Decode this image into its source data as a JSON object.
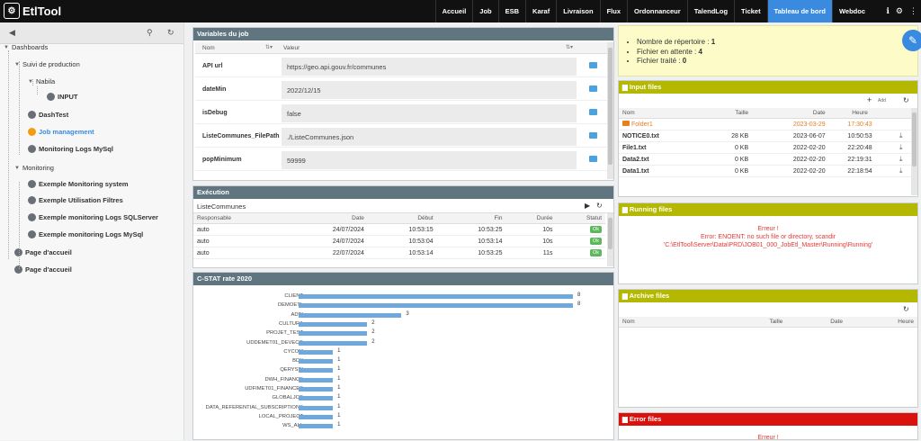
{
  "app": {
    "name": "EtlTool"
  },
  "nav": {
    "items": [
      "Accueil",
      "Job",
      "ESB",
      "Karaf",
      "Livraison",
      "Flux",
      "Ordonnanceur",
      "TalendLog",
      "Ticket",
      "Tableau de bord",
      "Webdoc"
    ],
    "active": "Tableau de bord"
  },
  "tree": [
    {
      "label": "Dashboards",
      "level": 0,
      "type": "folder"
    },
    {
      "label": "Suivi de production",
      "level": 1,
      "type": "folder"
    },
    {
      "label": "Nabila",
      "level": 2,
      "type": "folder"
    },
    {
      "label": "INPUT",
      "level": 3,
      "type": "item"
    },
    {
      "label": "DashTest",
      "level": 2,
      "type": "item"
    },
    {
      "label": "Job management",
      "level": 2,
      "type": "item",
      "selected": true
    },
    {
      "label": "Monitoring Logs MySql",
      "level": 2,
      "type": "item"
    },
    {
      "label": "Monitoring",
      "level": 1,
      "type": "folder"
    },
    {
      "label": "Exemple Monitoring system",
      "level": 2,
      "type": "item"
    },
    {
      "label": "Exemple Utilisation Filtres",
      "level": 2,
      "type": "item"
    },
    {
      "label": "Exemple monitoring Logs SQLServer",
      "level": 2,
      "type": "item"
    },
    {
      "label": "Exemple monitoring Logs MySql",
      "level": 2,
      "type": "item"
    },
    {
      "label": "Page d'accueil",
      "level": 1,
      "type": "item"
    },
    {
      "label": "Page d'accueil",
      "level": 1,
      "type": "item"
    }
  ],
  "variables": {
    "title": "Variables du job",
    "col_name": "Nom",
    "col_value": "Valeur",
    "rows": [
      {
        "k": "API url",
        "v": "https://geo.api.gouv.fr/communes"
      },
      {
        "k": "dateMin",
        "v": "2022/12/15"
      },
      {
        "k": "isDebug",
        "v": "false"
      },
      {
        "k": "ListeCommunes_FilePath",
        "v": "./ListeCommunes.json"
      },
      {
        "k": "popMinimum",
        "v": "59999"
      }
    ]
  },
  "execution": {
    "title": "Exécution",
    "job": "ListeCommunes",
    "headers": [
      "Responsable",
      "Date",
      "Début",
      "Fin",
      "Durée",
      "Statut"
    ],
    "rows": [
      [
        "auto",
        "24/07/2024",
        "10:53:15",
        "10:53:25",
        "10s",
        "Ok"
      ],
      [
        "auto",
        "24/07/2024",
        "10:53:04",
        "10:53:14",
        "10s",
        "Ok"
      ],
      [
        "auto",
        "22/07/2024",
        "10:53:14",
        "10:53:25",
        "11s",
        "Ok"
      ]
    ]
  },
  "chart_data": {
    "type": "bar",
    "title": "C-STAT rate 2020",
    "categories": [
      "CLIENT",
      "DEMOETL",
      "ADBI",
      "CULTURA",
      "PROJET_TEST",
      "UDDEMET01_DEVECO",
      "CYCOM",
      "BDX",
      "QERYSBI",
      "DWH_FINANCE",
      "UDFIMET01_FINANCES",
      "GLOBALJOB",
      "DATA_REFERENTIAL_SUBSCRIPTIONS",
      "LOCAL_PROJECT",
      "WS_ALL"
    ],
    "values": [
      8,
      8,
      3,
      2,
      2,
      2,
      1,
      1,
      1,
      1,
      1,
      1,
      1,
      1,
      1
    ],
    "xlim": [
      0,
      8
    ]
  },
  "summary": {
    "items": [
      {
        "label": "Nombre de répertoire : ",
        "value": "1"
      },
      {
        "label": "Fichier en attente : ",
        "value": "4"
      },
      {
        "label": "Fichier traité : ",
        "value": "0"
      }
    ]
  },
  "input_files": {
    "title": "Input files",
    "add_label": "Add",
    "headers": [
      "Nom",
      "Taille",
      "Date",
      "Heure"
    ],
    "rows": [
      {
        "name": "Folder1",
        "size": "",
        "date": "2023-03-29",
        "time": "17:30:43",
        "folder": true
      },
      {
        "name": "NOTICE0.txt",
        "size": "28 KB",
        "date": "2023-06-07",
        "time": "10:50:53"
      },
      {
        "name": "File1.txt",
        "size": "0 KB",
        "date": "2022-02-20",
        "time": "22:20:48"
      },
      {
        "name": "Data2.txt",
        "size": "0 KB",
        "date": "2022-02-20",
        "time": "22:19:31"
      },
      {
        "name": "Data1.txt",
        "size": "0 KB",
        "date": "2022-02-20",
        "time": "22:18:54"
      }
    ]
  },
  "running_files": {
    "title": "Running files",
    "error_title": "Erreur !",
    "error_msg": "Error: ENOENT: no such file or directory, scandir",
    "error_path": "'C:\\EtlTool\\Server\\Data\\PRD\\JOB01_000_JobEtl_Master\\Running\\Running'"
  },
  "archive_files": {
    "title": "Archive files",
    "headers": [
      "Nom",
      "Taille",
      "Date",
      "Heure"
    ]
  },
  "error_files": {
    "title": "Error files",
    "error_title": "Erreur !"
  },
  "colors": {
    "accent": "#3a8be0",
    "olive": "#b5b800",
    "red": "#d9120e",
    "panel_header": "#5f7580",
    "ok": "#5cb85c",
    "bar": "#6fa8dc"
  }
}
